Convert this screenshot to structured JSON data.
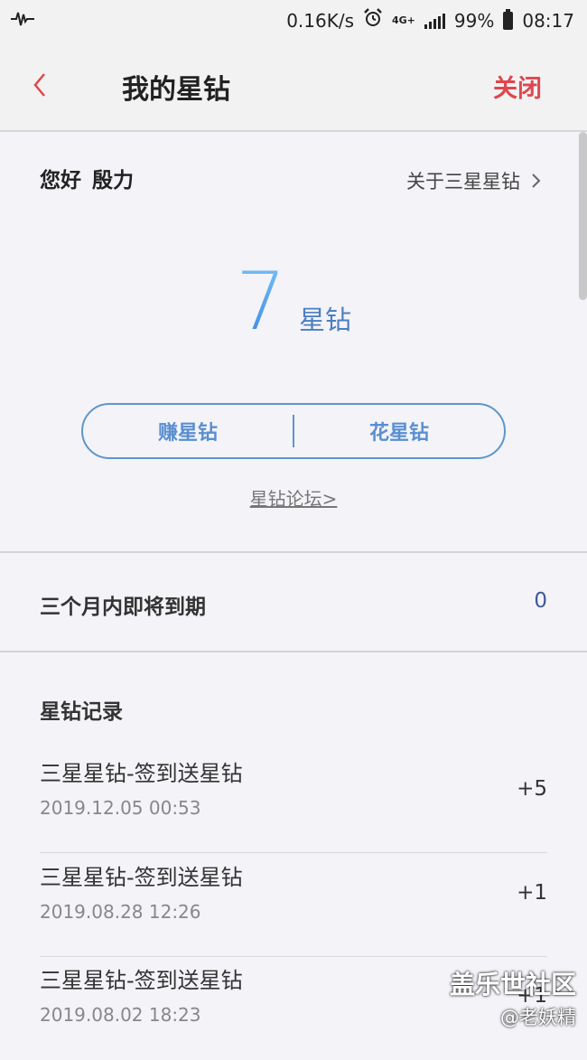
{
  "status_bar": {
    "speed": "0.16K/s",
    "network": "4G+",
    "battery": "99%",
    "time": "08:17",
    "icons": [
      "activity-icon",
      "alarm-icon",
      "signal-icon",
      "battery-icon"
    ]
  },
  "header": {
    "title": "我的星钻",
    "close_label": "关闭",
    "back_icon": "chevron-left-icon"
  },
  "greeting": {
    "hello": "您好",
    "name": "殷力",
    "about_link": "关于三星星钻"
  },
  "balance": {
    "value": "7",
    "unit": "星钻"
  },
  "actions": {
    "earn": "赚星钻",
    "spend": "花星钻"
  },
  "forum_link": "星钻论坛>",
  "expiring": {
    "label": "三个月内即将到期",
    "value": "0"
  },
  "records": {
    "title": "星钻记录",
    "items": [
      {
        "title": "三星星钻-签到送星钻",
        "date": "2019.12.05 00:53",
        "amount": "+5"
      },
      {
        "title": "三星星钻-签到送星钻",
        "date": "2019.08.28 12:26",
        "amount": "+1"
      },
      {
        "title": "三星星钻-签到送星钻",
        "date": "2019.08.02 18:23",
        "amount": "+1"
      }
    ]
  },
  "watermark": {
    "line1": "盖乐世社区",
    "line2": "@老妖精"
  },
  "colors": {
    "accent_red": "#e0464e",
    "accent_blue": "#5a8fd0",
    "balance_blue": "#5aaaf0"
  }
}
